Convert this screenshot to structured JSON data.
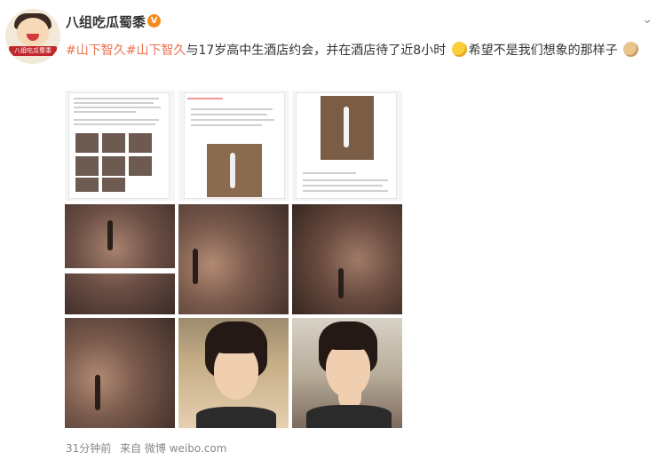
{
  "user": {
    "name": "八组吃瓜蜀黍",
    "avatar_caption": "八组吃瓜蜀黍",
    "verified_mark": "V"
  },
  "menu_icon": "chevron-down-icon",
  "post": {
    "tag1": "#山下智久",
    "tag2": "#山下智久",
    "text1": "与17岁高中生酒店约会，并在酒店待了近8小时",
    "text2": "希望不是我们想象的那样子",
    "emoji1": "sweat-emoji-icon",
    "emoji2": "doge-emoji-icon"
  },
  "footer": {
    "time": "31分钟前",
    "source": "来自 微博 weibo.com"
  },
  "colors": {
    "tag": "#eb7350",
    "verified": "#f78a1f",
    "muted": "#888888"
  }
}
